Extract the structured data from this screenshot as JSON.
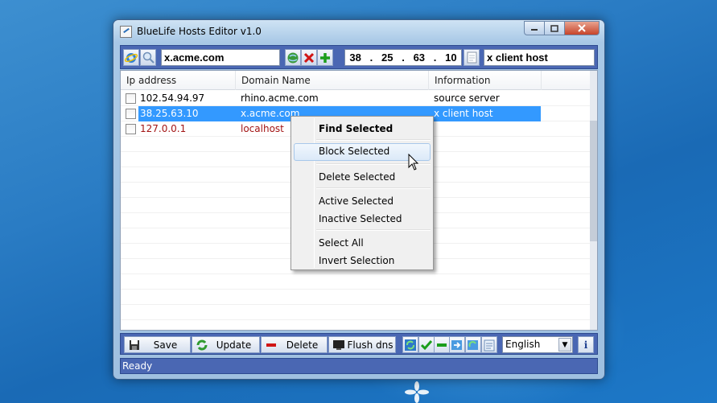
{
  "window": {
    "title": "BlueLife Hosts Editor v1.0"
  },
  "toolbar": {
    "domain_value": "x.acme.com",
    "ip_octets": [
      "38",
      "25",
      "63",
      "10"
    ],
    "info_value": "x client host"
  },
  "list": {
    "columns": [
      "Ip address",
      "Domain Name",
      "Information"
    ],
    "rows": [
      {
        "ip": "102.54.94.97",
        "domain": "rhino.acme.com",
        "info": "source server"
      },
      {
        "ip": "38.25.63.10",
        "domain": "x.acme.com",
        "info": "x client host"
      },
      {
        "ip": "127.0.0.1",
        "domain": "localhost",
        "info": ""
      }
    ]
  },
  "context_menu": {
    "items": [
      "Find Selected",
      "Block Selected",
      "Delete Selected",
      "Active Selected",
      "Inactive Selected",
      "Select All",
      "Invert Selection"
    ]
  },
  "bottombar": {
    "save": "Save",
    "update": "Update",
    "delete": "Delete",
    "flush": "Flush dns",
    "language": "English",
    "info": "i"
  },
  "status": {
    "text": "Ready"
  },
  "colors": {
    "accent_bar": "#4a67b3",
    "selection": "#3399ff",
    "inactive_text": "#a31515"
  }
}
